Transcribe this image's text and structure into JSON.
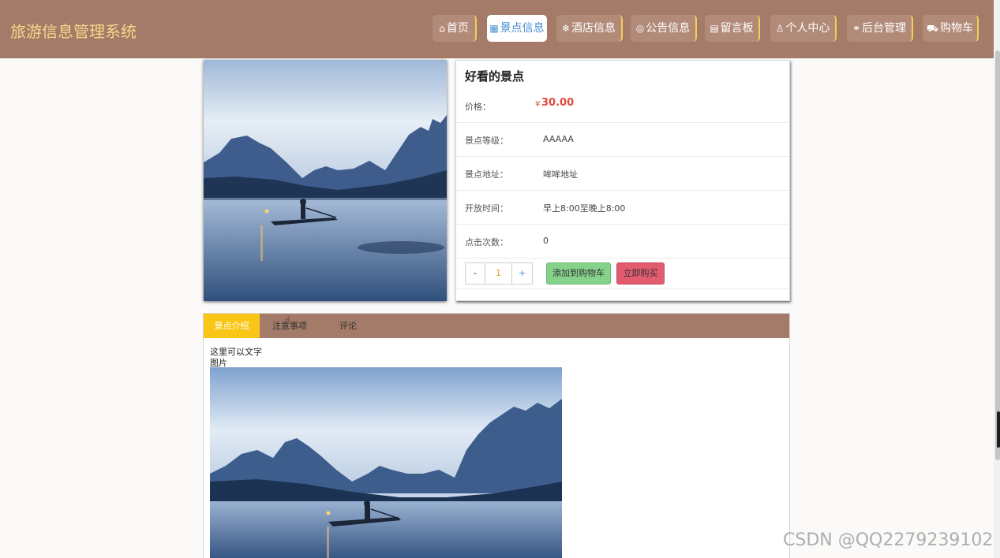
{
  "header": {
    "brand": "旅游信息管理系统",
    "nav": [
      {
        "icon": "home-icon",
        "glyph": "⌂",
        "label": "首页"
      },
      {
        "icon": "grid-icon",
        "glyph": "▦",
        "label": "景点信息",
        "active": true
      },
      {
        "icon": "snowflake-icon",
        "glyph": "❄",
        "label": "酒店信息"
      },
      {
        "icon": "palette-icon",
        "glyph": "◎",
        "label": "公告信息"
      },
      {
        "icon": "board-icon",
        "glyph": "▤",
        "label": "留言板"
      },
      {
        "icon": "user-icon",
        "glyph": "♙",
        "label": "个人中心"
      },
      {
        "icon": "link-icon",
        "glyph": "⚭",
        "label": "后台管理"
      },
      {
        "icon": "cart-icon",
        "glyph": "⛟",
        "label": "购物车"
      }
    ]
  },
  "product": {
    "title": "好看的景点",
    "price_label": "价格：",
    "currency": "¥",
    "price": "30.00",
    "fields": [
      {
        "label": "景点等级：",
        "value": "AAAAA"
      },
      {
        "label": "景点地址：",
        "value": "哞哞地址"
      },
      {
        "label": "开放时间：",
        "value": "早上8:00至晚上8:00"
      },
      {
        "label": "点击次数：",
        "value": "0"
      }
    ],
    "qty_minus": "-",
    "qty_value": "1",
    "qty_plus": "+",
    "add_to_cart": "添加到购物车",
    "buy_now": "立即购买"
  },
  "tabs": {
    "items": [
      "景点介绍",
      "注意事项",
      "评论"
    ],
    "active": 0,
    "content": {
      "line1": "这里可以文字",
      "line2": "图片"
    }
  },
  "watermark": "CSDN @QQ2279239102",
  "colors": {
    "header_bg": "#a47a68",
    "brand": "#f5d98a",
    "accent_yellow": "#f9c617",
    "price": "#e04a3b",
    "cart_button": "#85d38a",
    "buy_button": "#e25b6e"
  }
}
